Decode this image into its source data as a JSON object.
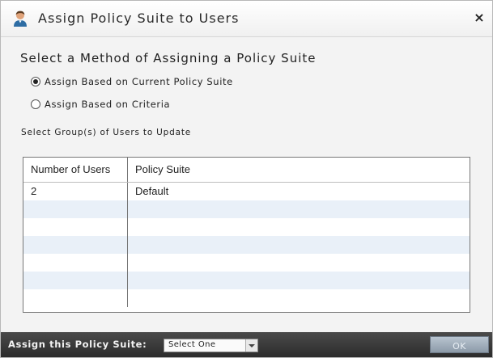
{
  "dialog": {
    "title": "Assign Policy Suite to Users",
    "icon": "user-icon",
    "close_label": "×"
  },
  "method": {
    "heading": "Select a Method of Assigning a Policy Suite",
    "options": [
      {
        "label": "Assign Based on Current Policy Suite",
        "checked": true
      },
      {
        "label": "Assign Based on Criteria",
        "checked": false
      }
    ]
  },
  "groups": {
    "heading": "Select Group(s) of Users to Update",
    "columns": [
      "Number of Users",
      "Policy Suite"
    ],
    "rows": [
      {
        "users": "2",
        "suite": "Default"
      }
    ]
  },
  "footer": {
    "label": "Assign this Policy Suite:",
    "select_value": "Select One",
    "ok_label": "OK"
  },
  "colors": {
    "row_alt": "#e9f0f8",
    "footer_bg": "#2c2c2c",
    "ok_button": "#9aa8b6"
  }
}
